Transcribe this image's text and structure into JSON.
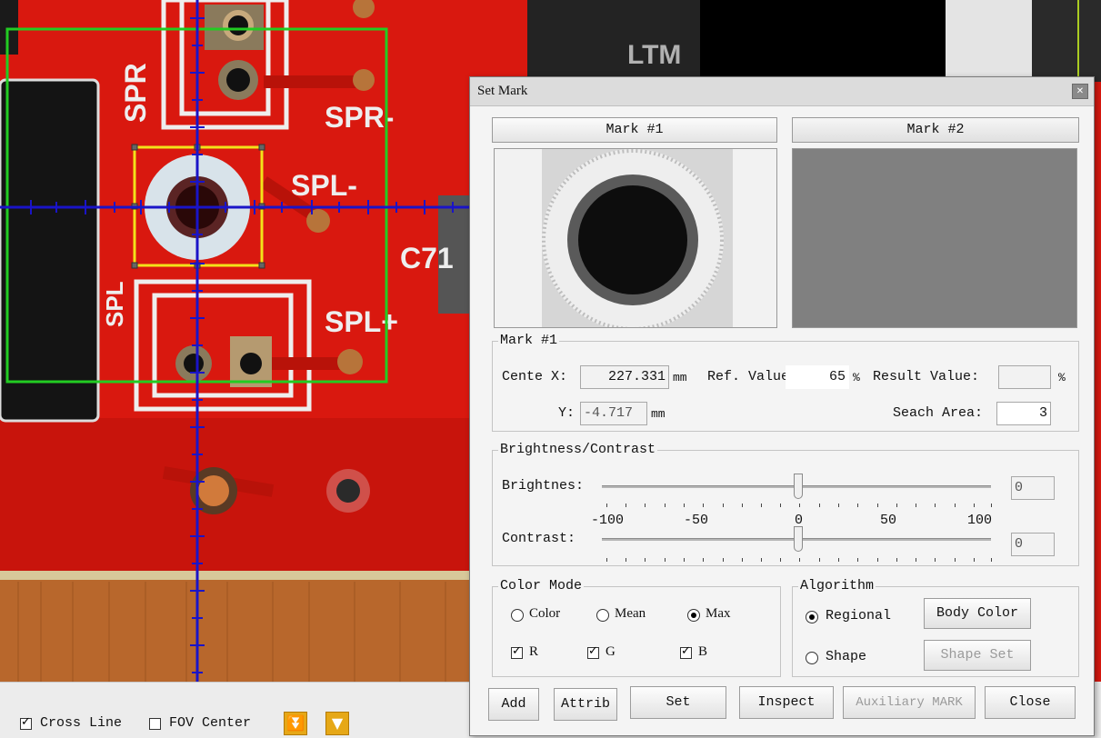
{
  "dialog": {
    "title": "Set Mark",
    "tabs": [
      "Mark #1",
      "Mark #2"
    ],
    "mark_group": {
      "title": "Mark #1",
      "center_x_label": "Cente X:",
      "center_x_value": "227.331",
      "center_x_unit": "mm",
      "y_label": "Y:",
      "y_value": "-4.717",
      "y_unit": "mm",
      "ref_label": "Ref. Value:",
      "ref_value": "65",
      "ref_unit": "%",
      "result_label": "Result Value:",
      "result_value": "",
      "result_unit": "%",
      "search_label": "Seach Area:",
      "search_value": "3"
    },
    "bc_group": {
      "title": "Brightness/Contrast",
      "brightness_label": "Brightnes:",
      "brightness_value": "0",
      "contrast_label": "Contrast:",
      "contrast_value": "0",
      "scale_labels": [
        "-100",
        "-50",
        "0",
        "50",
        "100"
      ]
    },
    "color_group": {
      "title": "Color Mode",
      "modes": [
        "Color",
        "Mean",
        "Max"
      ],
      "selected_mode": "Max",
      "channels": [
        "R",
        "G",
        "B"
      ]
    },
    "algo_group": {
      "title": "Algorithm",
      "options": [
        "Regional",
        "Shape"
      ],
      "selected": "Regional",
      "body_color_label": "Body Color",
      "shape_set_label": "Shape Set"
    },
    "buttons": {
      "add": "Add",
      "attrib": "Attrib",
      "set": "Set",
      "inspect": "Inspect",
      "auxiliary": "Auxiliary MARK",
      "close": "Close"
    }
  },
  "statusbar": {
    "cross_line_label": "Cross Line",
    "cross_line_checked": true,
    "fov_center_label": "FOV Center",
    "fov_center_checked": false
  },
  "pcb_labels": {
    "spr": "SPR",
    "spr_minus": "SPR-",
    "spl_minus": "SPL-",
    "spl_plus": "SPL+",
    "spl": "SPL",
    "c71": "C71",
    "ltm": "LTM"
  },
  "colors": {
    "board_red": "#d9180f",
    "crosshair": "#1a14c8",
    "fov_box": "#22cc22",
    "mark_box": "#f2e21a",
    "accent_orange": "#e6a817"
  }
}
